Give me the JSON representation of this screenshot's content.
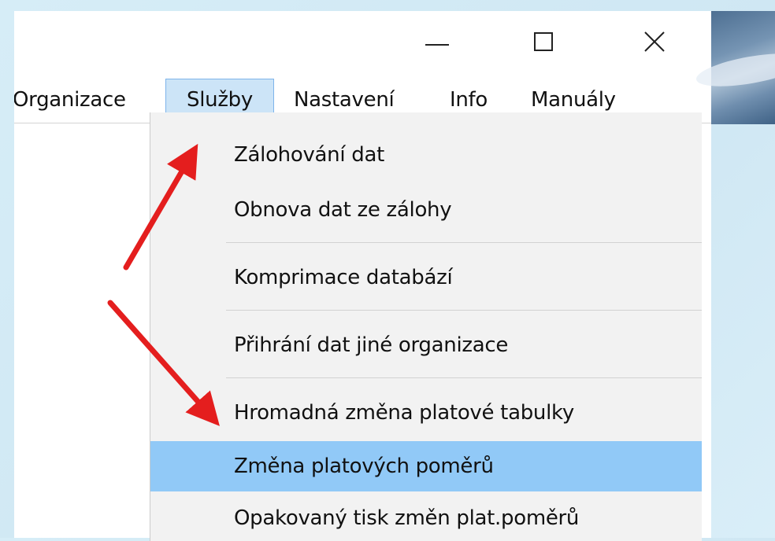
{
  "window": {
    "controls": {
      "minimize_icon": "minimize-icon",
      "maximize_icon": "maximize-icon",
      "close_icon": "close-icon"
    }
  },
  "menubar": {
    "items": [
      {
        "label": "Organizace"
      },
      {
        "label": "Služby"
      },
      {
        "label": "Nastavení"
      },
      {
        "label": "Info"
      },
      {
        "label": "Manuály"
      }
    ],
    "active_item": "Služby"
  },
  "dropdown": {
    "items": [
      {
        "label": "Zálohování dat"
      },
      {
        "label": "Obnova dat ze zálohy"
      },
      {
        "label": "Komprimace databází"
      },
      {
        "label": "Přihrání dat jiné organizace"
      },
      {
        "label": "Hromadná změna platové tabulky"
      },
      {
        "label": "Změna platových poměrů"
      },
      {
        "label": "Opakovaný tisk změn plat.poměrů"
      }
    ],
    "highlighted_item": "Změna platových poměrů"
  },
  "colors": {
    "highlight": "#91c9f7",
    "menu_active": "#cce4f7",
    "annotation_arrow": "#e41e1e"
  }
}
